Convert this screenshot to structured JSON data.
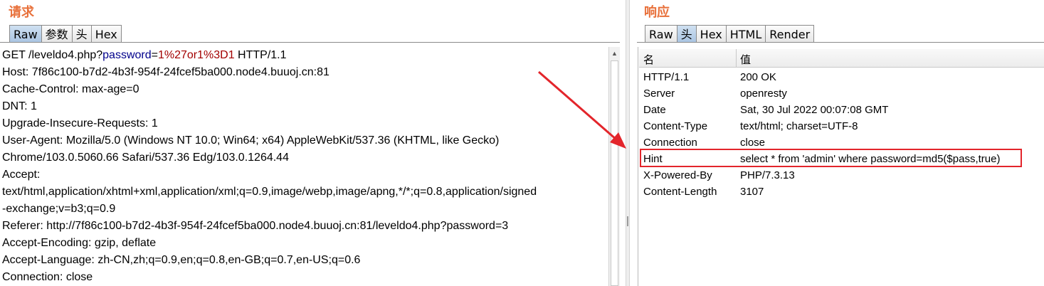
{
  "request": {
    "title": "请求",
    "tabs": [
      "Raw",
      "参数",
      "头",
      "Hex"
    ],
    "active_tab": "Raw",
    "request_line": {
      "prefix": "GET /leveldo4.php?",
      "param_name": "password",
      "eq": "=",
      "param_value": "1%27or1%3D1",
      "suffix": " HTTP/1.1"
    },
    "lines": [
      "Host: 7f86c100-b7d2-4b3f-954f-24fcef5ba000.node4.buuoj.cn:81",
      "Cache-Control: max-age=0",
      "DNT: 1",
      "Upgrade-Insecure-Requests: 1",
      "User-Agent: Mozilla/5.0 (Windows NT 10.0; Win64; x64) AppleWebKit/537.36 (KHTML, like Gecko)",
      "Chrome/103.0.5060.66 Safari/537.36 Edg/103.0.1264.44",
      "Accept:",
      "text/html,application/xhtml+xml,application/xml;q=0.9,image/webp,image/apng,*/*;q=0.8,application/signed",
      "-exchange;v=b3;q=0.9",
      "Referer: http://7f86c100-b7d2-4b3f-954f-24fcef5ba000.node4.buuoj.cn:81/leveldo4.php?password=3",
      "Accept-Encoding: gzip, deflate",
      "Accept-Language: zh-CN,zh;q=0.9,en;q=0.8,en-GB;q=0.7,en-US;q=0.6",
      "Connection: close"
    ]
  },
  "response": {
    "title": "响应",
    "tabs": [
      "Raw",
      "头",
      "Hex",
      "HTML",
      "Render"
    ],
    "active_tab": "头",
    "columns": [
      "名",
      "值"
    ],
    "headers": [
      {
        "name": "HTTP/1.1",
        "value": "200 OK"
      },
      {
        "name": "Server",
        "value": "openresty"
      },
      {
        "name": "Date",
        "value": "Sat, 30 Jul 2022 00:07:08 GMT"
      },
      {
        "name": "Content-Type",
        "value": "text/html; charset=UTF-8"
      },
      {
        "name": "Connection",
        "value": "close"
      },
      {
        "name": "Hint",
        "value": "select * from 'admin' where password=md5($pass,true)"
      },
      {
        "name": "X-Powered-By",
        "value": "PHP/7.3.13"
      },
      {
        "name": "Content-Length",
        "value": "3107"
      }
    ]
  },
  "colors": {
    "title": "#e8703a",
    "param_name": "#00008b",
    "param_value": "#a30000",
    "highlight_box": "#e3252b",
    "arrow": "#e3252b"
  }
}
